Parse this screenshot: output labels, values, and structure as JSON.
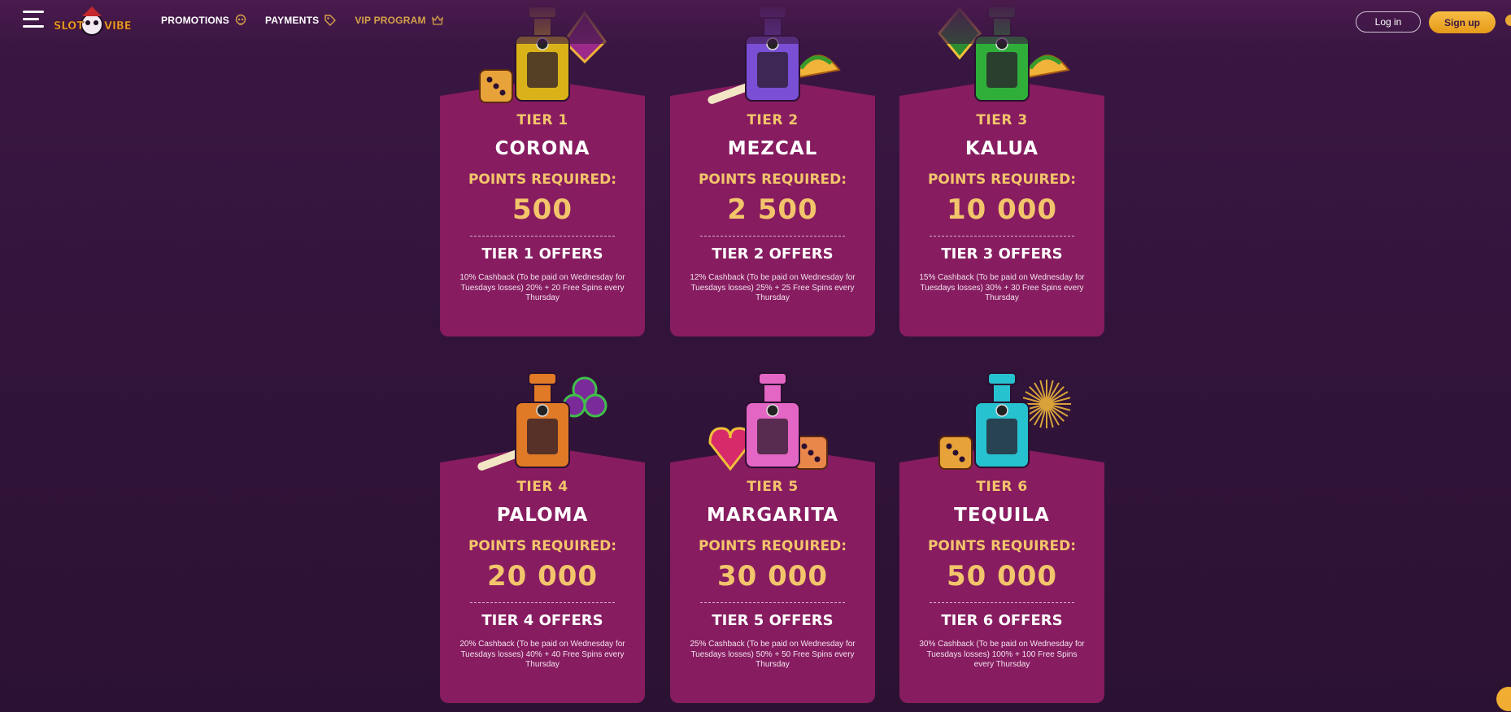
{
  "header": {
    "logo_text": "SLOT VIBE",
    "nav": [
      {
        "label": "PROMOTIONS",
        "icon": "skull-icon"
      },
      {
        "label": "PAYMENTS",
        "icon": "tag-icon"
      },
      {
        "label": "VIP PROGRAM",
        "icon": "vip-crown-icon"
      }
    ],
    "login_label": "Log in",
    "signup_label": "Sign up"
  },
  "colors": {
    "background": "#33143c",
    "card": "#871c60",
    "accent_gold": "#f3c56b",
    "signup_button": "#f0ad32"
  },
  "tiers": [
    {
      "tier": "TIER 1",
      "name": "CORONA",
      "points_label": "POINTS REQUIRED:",
      "points": "500",
      "offers_title": "TIER 1 OFFERS",
      "offers_text": "10% Cashback (To be paid on Wednesday for Tuesdays losses) 20% + 20 Free Spins every Thursday",
      "bottle_color": "#d9b21a",
      "extras": [
        "dice",
        "spade"
      ]
    },
    {
      "tier": "TIER 2",
      "name": "MEZCAL",
      "points_label": "POINTS REQUIRED:",
      "points": "2 500",
      "offers_title": "TIER 2 OFFERS",
      "offers_text": "12% Cashback (To be paid on Wednesday for Tuesdays losses) 25% + 25 Free Spins every Thursday",
      "bottle_color": "#7a4fd6",
      "extras": [
        "bone",
        "taco"
      ]
    },
    {
      "tier": "TIER 3",
      "name": "KALUA",
      "points_label": "POINTS REQUIRED:",
      "points": "10 000",
      "offers_title": "TIER 3 OFFERS",
      "offers_text": "15% Cashback (To be paid on Wednesday for Tuesdays losses) 30% + 30 Free Spins every Thursday",
      "bottle_color": "#2fae3a",
      "extras": [
        "diamond",
        "taco"
      ]
    },
    {
      "tier": "TIER 4",
      "name": "PALOMA",
      "points_label": "POINTS REQUIRED:",
      "points": "20 000",
      "offers_title": "TIER 4 OFFERS",
      "offers_text": "20% Cashback (To be paid on Wednesday for Tuesdays losses) 40% + 40 Free Spins every Thursday",
      "bottle_color": "#e07a26",
      "extras": [
        "bone",
        "club"
      ]
    },
    {
      "tier": "TIER 5",
      "name": "MARGARITA",
      "points_label": "POINTS REQUIRED:",
      "points": "30 000",
      "offers_title": "TIER 5 OFFERS",
      "offers_text": "25% Cashback (To be paid on Wednesday for Tuesdays losses) 50% + 50 Free Spins every Thursday",
      "bottle_color": "#e366c4",
      "extras": [
        "heart",
        "dice"
      ]
    },
    {
      "tier": "TIER 6",
      "name": "TEQUILA",
      "points_label": "POINTS REQUIRED:",
      "points": "50 000",
      "offers_title": "TIER 6 OFFERS",
      "offers_text": "30% Cashback (To be paid on Wednesday for Tuesdays losses) 100% + 100 Free Spins every Thursday",
      "bottle_color": "#27c2cf",
      "extras": [
        "dice",
        "firework"
      ]
    }
  ]
}
